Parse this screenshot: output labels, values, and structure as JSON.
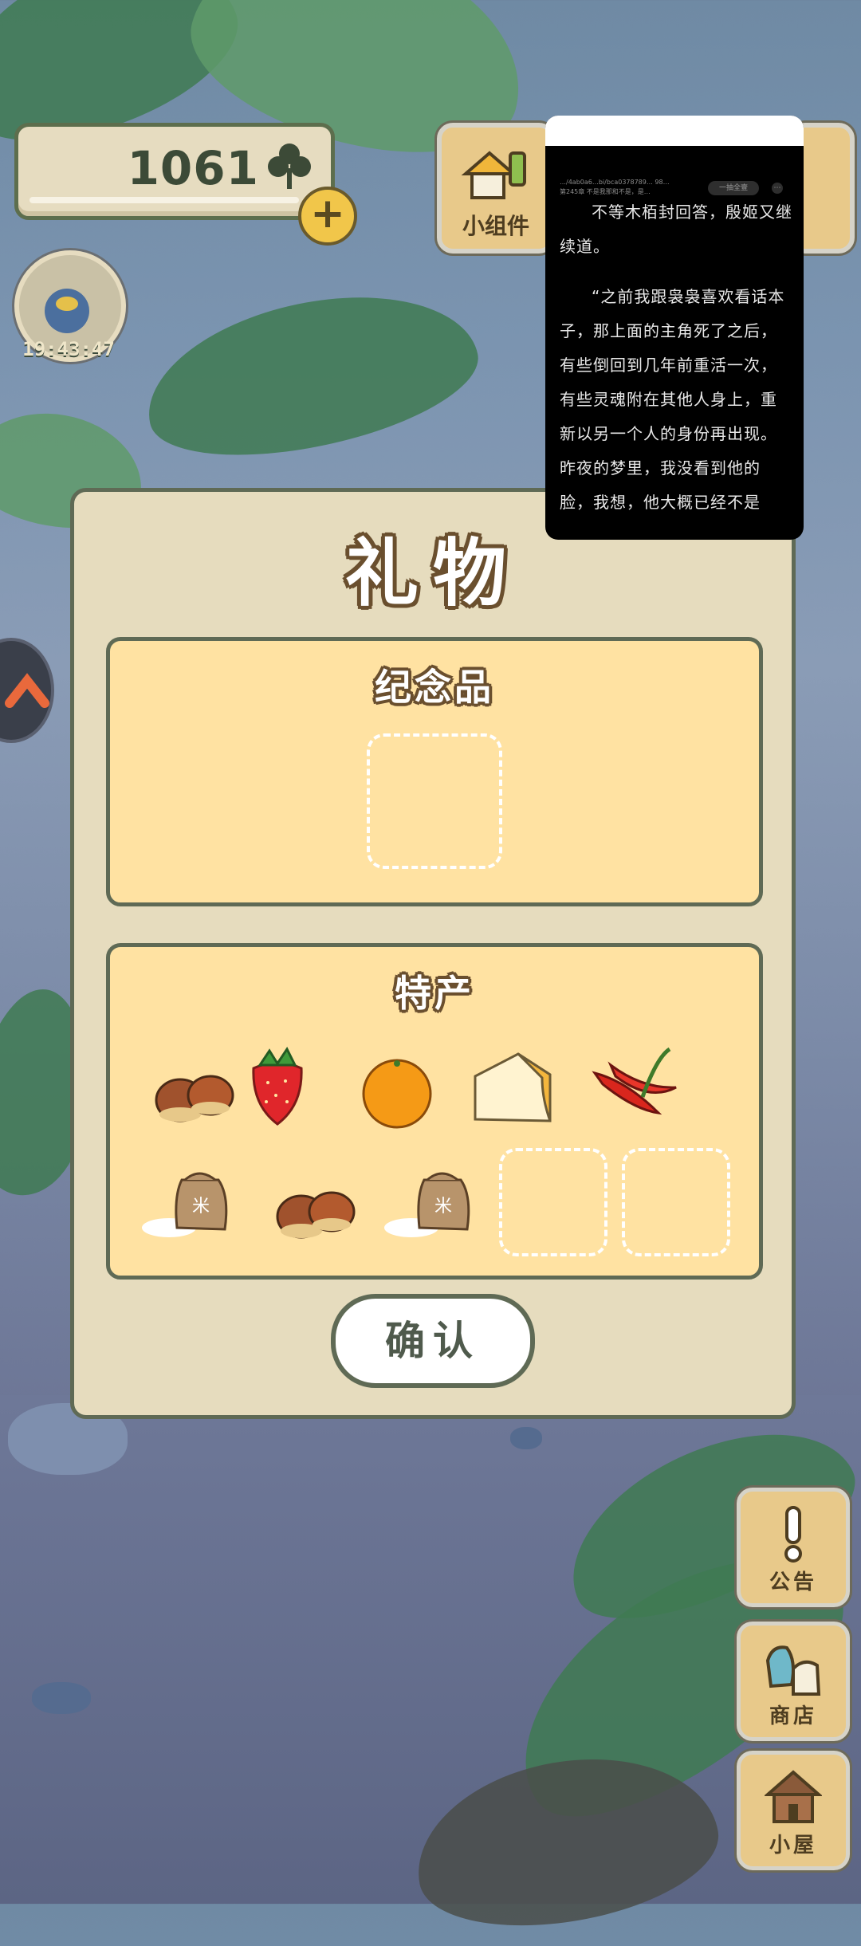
{
  "currency": {
    "clover_count": "1061",
    "icon": "clover-icon",
    "add_icon": "plus-icon"
  },
  "visitor_timer": "19:43:47",
  "widget_button": {
    "label": "小组件",
    "icon": "widget-icon"
  },
  "reader_overlay": {
    "meta_lines": [
      "…/4ab0a6…bi/bca0378789… 98…",
      "第245章 不是我那和不是，是…"
    ],
    "pill_label": "一抽全壹",
    "paragraphs": [
      "不等木栢封回答，殷姬又继续道。",
      "“之前我跟袅袅喜欢看话本子，那上面的主角死了之后，有些倒回到几年前重活一次，有些灵魂附在其他人身上，重新以另一个人的身份再出现。昨夜的梦里，我没看到他的脸，我想，他大概已经不是"
    ]
  },
  "gift_dialog": {
    "title": "礼物",
    "souvenir_section": {
      "title": "纪念品",
      "slots": [
        {
          "filled": false
        }
      ]
    },
    "specialty_section": {
      "title": "特产",
      "items": [
        "chestnut",
        "strawberry",
        "orange",
        "cheese",
        "chili-pepper",
        "rice-bag",
        "chestnut",
        "rice-bag",
        "empty",
        "empty"
      ]
    },
    "confirm_label": "确认"
  },
  "side_menu": [
    {
      "label": "公告",
      "icon": "notice-icon"
    },
    {
      "label": "商店",
      "icon": "shop-icon"
    },
    {
      "label": "小屋",
      "icon": "house-icon"
    }
  ],
  "colors": {
    "panel_bg": "#e6dcbe",
    "section_bg": "#ffe2a2",
    "outline": "#5f6a55",
    "title_outline": "#6a4f2e",
    "wood_button": "#e8c98a"
  }
}
